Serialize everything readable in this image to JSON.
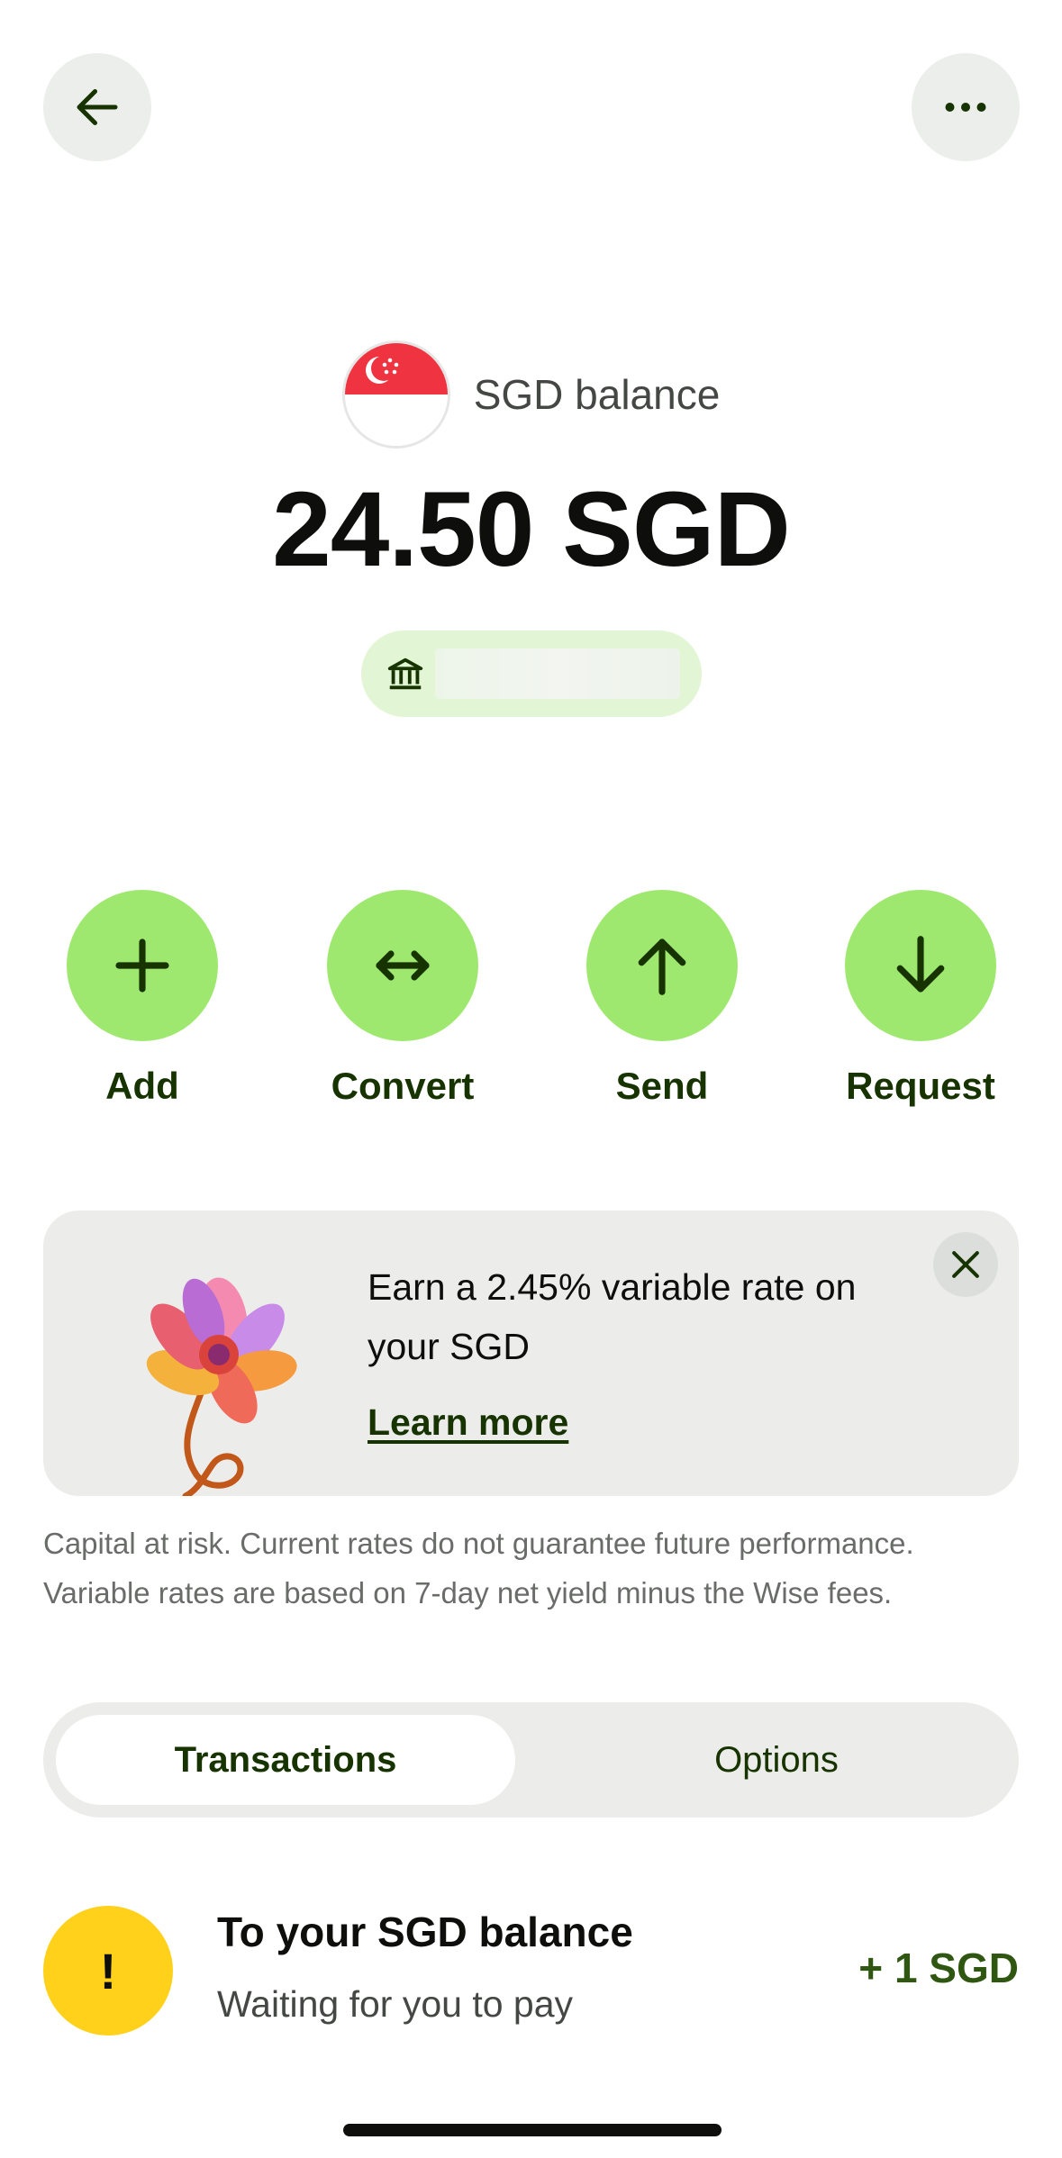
{
  "header": {
    "back_icon": "arrow-left-icon",
    "more_icon": "more-horizontal-icon"
  },
  "balance": {
    "flag_icon": "singapore-flag-icon",
    "label": "SGD balance",
    "amount": "24.50 SGD",
    "account_icon": "bank-icon"
  },
  "actions": [
    {
      "label": "Add",
      "icon": "plus-icon"
    },
    {
      "label": "Convert",
      "icon": "convert-arrows-icon"
    },
    {
      "label": "Send",
      "icon": "arrow-up-icon"
    },
    {
      "label": "Request",
      "icon": "arrow-down-icon"
    }
  ],
  "promo": {
    "text": "Earn a 2.45% variable rate on your SGD",
    "link": "Learn more",
    "close_icon": "close-icon"
  },
  "disclaimer": "Capital at risk. Current rates do not guarantee future performance. Variable rates are based on 7-day net yield minus the Wise fees.",
  "tabs": [
    {
      "label": "Transactions",
      "active": true
    },
    {
      "label": "Options",
      "active": false
    }
  ],
  "transactions": [
    {
      "icon_text": "!",
      "title": "To your SGD balance",
      "status": "Waiting for you to pay",
      "amount": "+ 1 SGD"
    }
  ],
  "colors": {
    "accent": "#9fe870",
    "accent_dark": "#163300",
    "pending": "#ffd11a",
    "pill_bg": "#e2f6d5"
  }
}
